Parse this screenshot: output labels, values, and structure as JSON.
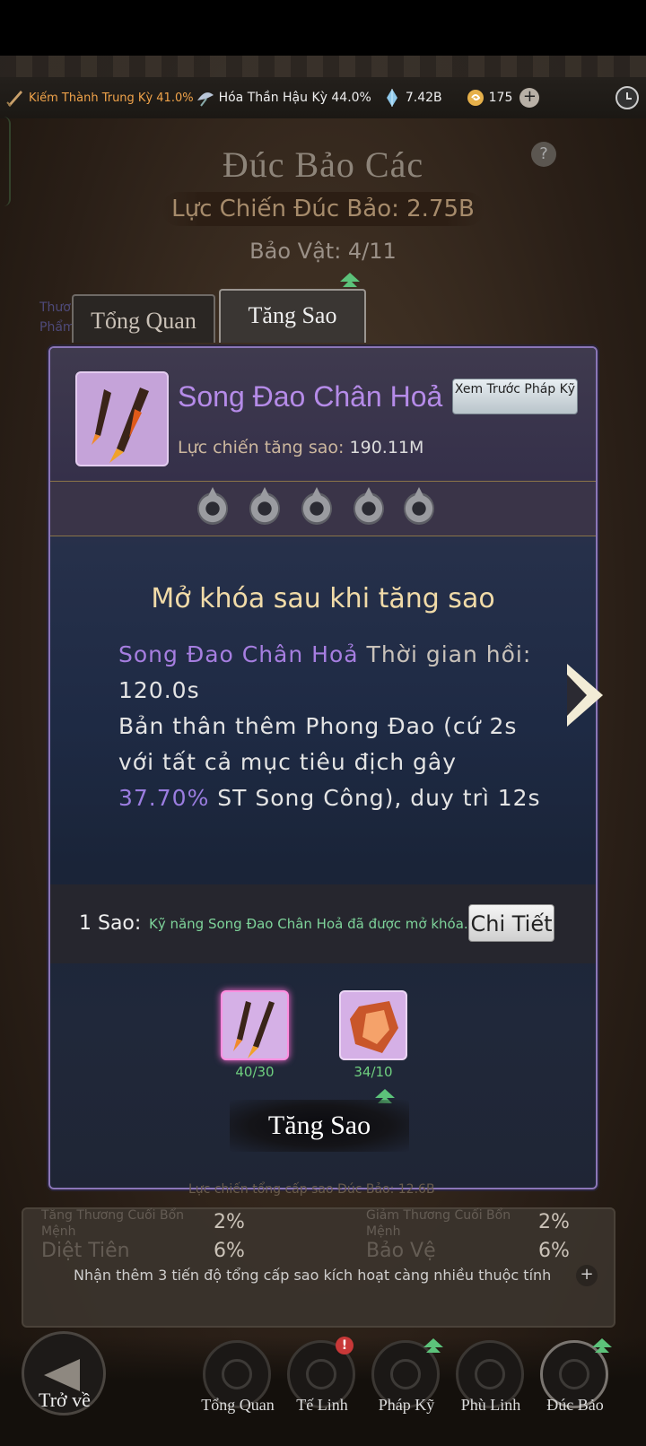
{
  "resources": {
    "cultivation_a": "Kiếm Thành Trung Kỳ 41.0%",
    "cultivation_b": "Hóa Thần Hậu Kỳ 44.0%",
    "crystals": "7.42B",
    "currency": "175",
    "plus_label": "+"
  },
  "header": {
    "title": "Đúc Bảo Các",
    "help_label": "?",
    "power_label": "Lực Chiến Đúc Bảo: 2.75B",
    "artifact_count": "Bảo Vật: 4/11"
  },
  "side_text": [
    "Thươ",
    "Phẩm"
  ],
  "tabs": {
    "overview": "Tổng Quan",
    "starup": "Tăng Sao"
  },
  "item": {
    "name": "Song Đao Chân Hoả",
    "preview_button": "Xem Trước Pháp Kỹ",
    "power_label": "Lực chiến tăng sao:",
    "power_value": "190.11M",
    "star_count": 5
  },
  "unlock": {
    "title": "Mở khóa sau khi tăng sao",
    "skill_name": "Song Đao Chân Hoả",
    "cooldown_label": "Thời gian hồi:",
    "cooldown_value": "120.0s",
    "desc_part1": "Bản thân thêm Phong Đao (cứ 2s với tất cả mục tiêu địch gây",
    "desc_pct": "37.70%",
    "desc_part2": "ST Song Công), duy trì 12s"
  },
  "star_level": {
    "label": "1 Sao:",
    "desc": "Kỹ năng Song Đao Chân Hoả đã được mở khóa.",
    "detail_button": "Chi Tiết"
  },
  "materials": [
    {
      "count": "40/30"
    },
    {
      "count": "34/10"
    }
  ],
  "starup_button": "Tăng Sao",
  "behind_text": "Lực chiến tổng cấp sao Đúc Bảo: 12.6B",
  "stats": {
    "row1_left_label": "Tăng Thương Cuối Bổn Mệnh",
    "row1_left_value": "2%",
    "row1_right_label": "Giảm Thương Cuối Bổn Mệnh",
    "row1_right_value": "2%",
    "row2_left_label": "Diệt Tiên",
    "row2_left_value": "6%",
    "row2_right_label": "Bảo Vệ",
    "row2_right_value": "6%",
    "note": "Nhận thêm 3 tiến độ tổng cấp sao kích hoạt càng nhiều thuộc tính",
    "plus": "+"
  },
  "nav": {
    "back": "Trở về",
    "items": [
      "Tổng Quan",
      "Tế Linh",
      "Pháp Kỹ",
      "Phù Linh",
      "Đúc Bảo"
    ],
    "badge": "!"
  },
  "colors": {
    "accent_purple": "#b58be8",
    "gold_text": "#f1dba8",
    "green_text": "#7ed39a",
    "panel_border": "#8b76b8"
  }
}
